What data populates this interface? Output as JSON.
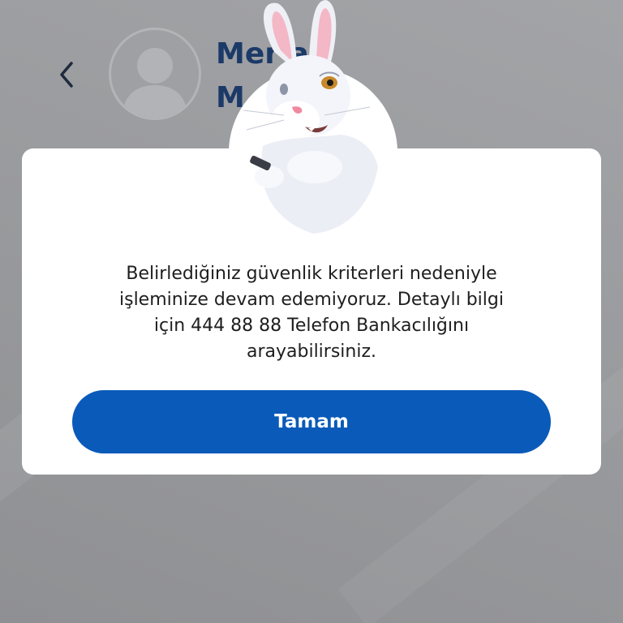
{
  "header": {
    "back_icon": "chevron-left-icon",
    "avatar_icon": "user-placeholder-icon",
    "name_line1": "Mer   a",
    "name_line2": "M         et"
  },
  "dialog": {
    "mascot_icon": "rabbit-mascot",
    "message": "Belirlediğiniz güvenlik kriterleri nedeniyle\nişleminize devam edemiyoruz. Detaylı bilgi\niçin 444 88 88 Telefon Bankacılığını\narayabilirsiniz.",
    "button_label": "Tamam"
  },
  "colors": {
    "overlay_background": "#9b9c9f",
    "dialog_background": "#ffffff",
    "primary_button": "#0a5ab9",
    "name_text": "#1c3a68",
    "message_text": "#1e1e1e"
  }
}
